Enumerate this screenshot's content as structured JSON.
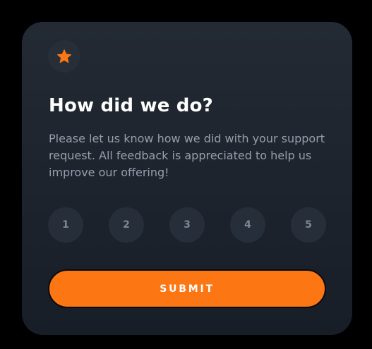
{
  "card": {
    "icon": "star-icon",
    "title": "How did we do?",
    "description": "Please let us know how we did with your support request. All feedback is appreciated to help us improve our offering!",
    "ratings": [
      "1",
      "2",
      "3",
      "4",
      "5"
    ],
    "submit_label": "SUBMIT"
  },
  "colors": {
    "accent": "#fc7614",
    "card_background": "#1f2630",
    "rating_background": "#262f39",
    "text_muted": "#969fad",
    "page_background": "#000000"
  }
}
